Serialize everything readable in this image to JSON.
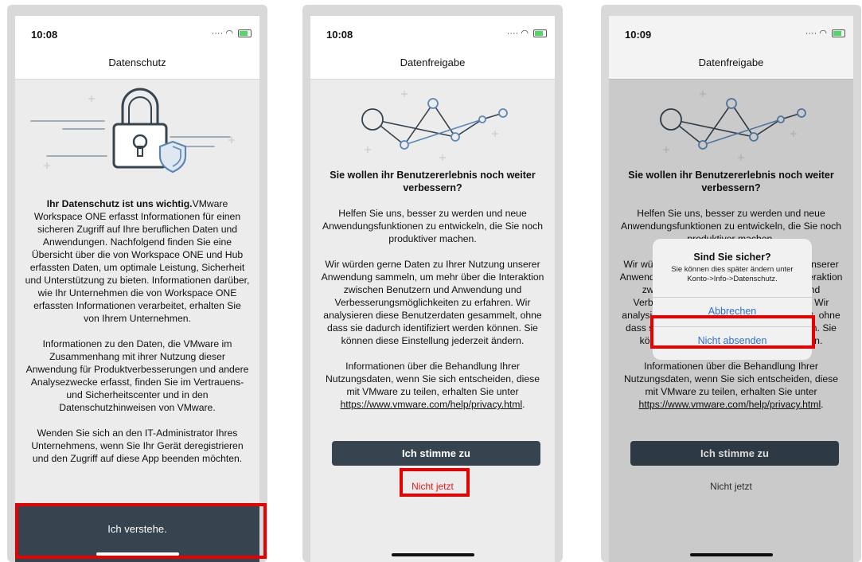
{
  "screen1": {
    "time": "10:08",
    "nav_title": "Datenschutz",
    "intro_bold": "Ihr Datenschutz ist uns wichtig.",
    "intro_text": "VMware Workspace ONE erfasst Informationen für einen sicheren Zugriff auf Ihre beruflichen Daten und Anwendungen. Nachfolgend finden Sie eine Übersicht über die von Workspace ONE und Hub erfassten Daten, um optimale Leistung, Sicherheit und Unterstützung zu bieten. Informationen darüber, wie Ihr Unternehmen die von Workspace ONE erfassten Informationen verarbeitet, erhalten Sie von Ihrem Unternehmen.",
    "paragraph2": "Informationen zu den Daten, die VMware im Zusammenhang mit ihrer Nutzung dieser Anwendung für Produktverbesserungen und andere Analysezwecke erfasst, finden Sie im Vertrauens- und Sicherheitscenter und in den Datenschutzhinweisen von VMware.",
    "paragraph3": "Wenden Sie sich an den IT-Administrator Ihres Unternehmens, wenn Sie Ihr Gerät deregistrieren und den Zugriff auf diese App beenden möchten.",
    "button_label": "Ich verstehe."
  },
  "screen2": {
    "time": "10:08",
    "nav_title": "Datenfreigabe",
    "headline": "Sie wollen ihr Benutzererlebnis noch weiter verbessern?",
    "paragraph1": "Helfen Sie uns, besser zu werden und neue Anwendungsfunktionen zu entwickeln, die Sie noch produktiver machen.",
    "paragraph2": "Wir würden gerne Daten zu Ihrer Nutzung unserer Anwendung sammeln, um mehr über die Interaktion zwischen Benutzern und Anwendung und Verbesserungsmöglichkeiten zu erfahren. Wir analysieren diese Benutzerdaten gesammelt, ohne dass sie dadurch identifiziert werden können. Sie können diese Einstellung jederzeit ändern.",
    "paragraph3": "Informationen über die Behandlung Ihrer Nutzungsdaten, wenn Sie sich entscheiden, diese mit VMware zu teilen, erhalten Sie unter",
    "link": "https://www.vmware.com/help/privacy.html",
    "link_suffix": ".",
    "agree_label": "Ich stimme zu",
    "not_now_label": "Nicht jetzt"
  },
  "screen3": {
    "time": "10:09",
    "nav_title": "Datenfreigabe",
    "alert": {
      "title": "Sind Sie sicher?",
      "message": "Sie können dies später ändern unter Konto->Info->Datenschutz.",
      "cancel_label": "Abbrechen",
      "confirm_label": "Nicht absenden"
    }
  },
  "colors": {
    "accent_dark": "#36444f",
    "highlight_red": "#e60000",
    "alert_link": "#2c6fd6"
  }
}
